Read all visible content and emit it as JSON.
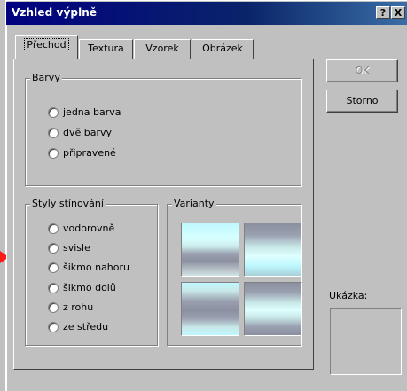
{
  "window": {
    "title": "Vzhled výplně",
    "help_label": "?",
    "close_label": "X"
  },
  "tabs": [
    {
      "label": "Přechod",
      "active": true
    },
    {
      "label": "Textura",
      "active": false
    },
    {
      "label": "Vzorek",
      "active": false
    },
    {
      "label": "Obrázek",
      "active": false
    }
  ],
  "colors_group": {
    "legend": "Barvy",
    "options": [
      "jedna barva",
      "dvě barvy",
      "připravené"
    ]
  },
  "shading_group": {
    "legend": "Styly stínování",
    "options": [
      "vodorovně",
      "svisle",
      "šikmo nahoru",
      "šikmo dolů",
      "z rohu",
      "ze středu"
    ]
  },
  "variants_group": {
    "legend": "Varianty",
    "swatches": [
      "variant-1",
      "variant-2",
      "variant-3",
      "variant-4"
    ]
  },
  "buttons": {
    "ok_label": "OK",
    "cancel_label": "Storno"
  },
  "preview": {
    "label": "Ukázka:"
  },
  "colors": {
    "titlebar": "#000080",
    "face": "#c0c0c0"
  }
}
